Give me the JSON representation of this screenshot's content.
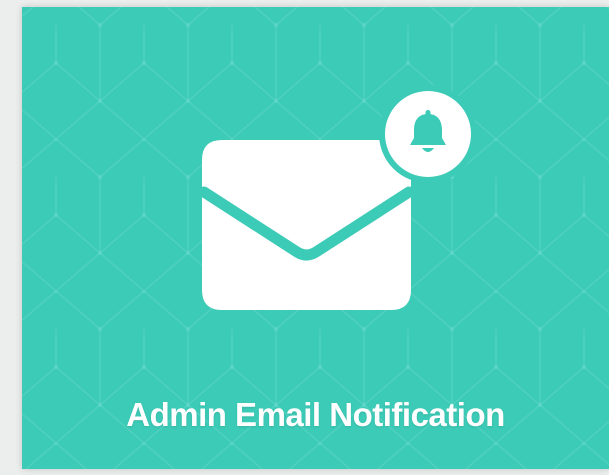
{
  "card": {
    "title": "Admin Email Notification",
    "icons": [
      "envelope-icon",
      "bell-icon"
    ],
    "colors": {
      "background": "#3ccbb7",
      "pattern_line": "#5cd6c5",
      "foreground": "#ffffff",
      "frame": "#eceeed"
    }
  }
}
